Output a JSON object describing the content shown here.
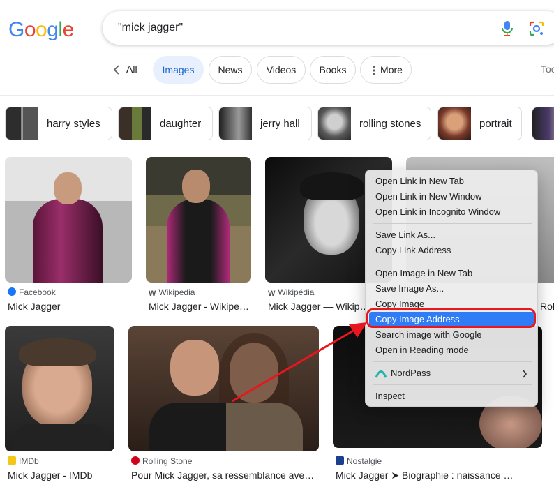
{
  "logo": {
    "text": "Google",
    "letters": [
      "G",
      "o",
      "o",
      "g",
      "l",
      "e"
    ]
  },
  "search": {
    "query": "\"mick jagger\""
  },
  "tabs": {
    "all": "All",
    "items": [
      "Images",
      "News",
      "Videos",
      "Books",
      "More"
    ],
    "tools": "Too"
  },
  "chips": [
    "harry styles",
    "daughter",
    "jerry hall",
    "rolling stones",
    "portrait"
  ],
  "results": [
    {
      "source": "Facebook",
      "title": "Mick Jagger"
    },
    {
      "source": "Wikipedia",
      "title": "Mick Jagger - Wikipe…"
    },
    {
      "source": "Wikipédia",
      "title": "Mick Jagger — Wikip…"
    },
    {
      "source": "",
      "title": "Rol"
    },
    {
      "source": "IMDb",
      "title": "Mick Jagger - IMDb"
    },
    {
      "source": "Rolling Stone",
      "title": "Pour Mick Jagger, sa ressemblance ave…"
    },
    {
      "source": "Nostalgie",
      "title": "Mick Jagger ➤ Biographie : naissance …"
    }
  ],
  "context_menu": {
    "items": [
      "Open Link in New Tab",
      "Open Link in New Window",
      "Open Link in Incognito Window",
      "Save Link As...",
      "Copy Link Address",
      "Open Image in New Tab",
      "Save Image As...",
      "Copy Image",
      "Copy Image Address",
      "Search image with Google",
      "Open in Reading mode",
      "NordPass",
      "Inspect"
    ],
    "highlighted": "Copy Image Address"
  },
  "colors": {
    "accent": "#1a73e8",
    "highlight": "#2f7cf6",
    "annotation": "#e8161d"
  }
}
